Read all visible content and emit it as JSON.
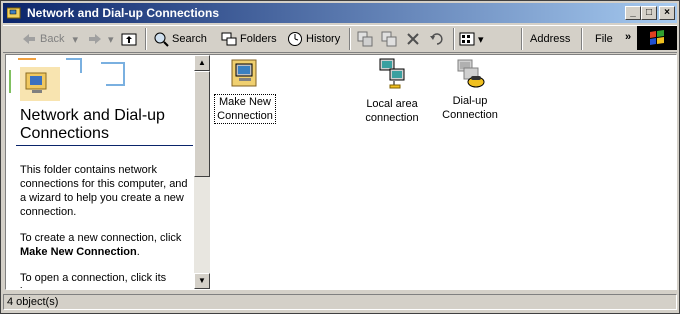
{
  "window": {
    "title": "Network and Dial-up Connections"
  },
  "titlebar_buttons": {
    "minimize": "_",
    "maximize": "□",
    "close": "×"
  },
  "toolbar": {
    "back": "Back",
    "search": "Search",
    "folders": "Folders",
    "history": "History",
    "address": "Address",
    "file": "File",
    "chevron": "»"
  },
  "left_pane": {
    "title_line1": "Network and Dial-up",
    "title_line2": "Connections",
    "para1": "This folder contains network connections for this computer, and a wizard to help you create a new connection.",
    "para2_prefix": "To create a new connection, click ",
    "para2_bold": "Make New Connection",
    "para2_suffix": ".",
    "para3": "To open a connection, click its icon."
  },
  "items": [
    {
      "label_line1": "Make New",
      "label_line2": "Connection",
      "icon": "make-new-connection-icon"
    },
    {
      "label_line1": "Local area",
      "label_line2": "connection",
      "icon": "local-area-connection-icon"
    },
    {
      "label_line1": "Dial-up",
      "label_line2": "Connection",
      "icon": "dial-up-connection-icon"
    }
  ],
  "statusbar": {
    "text": "4 object(s)"
  },
  "colors": {
    "titlebar_start": "#0a246a",
    "titlebar_end": "#a6caf0",
    "face": "#d4d0c8"
  }
}
